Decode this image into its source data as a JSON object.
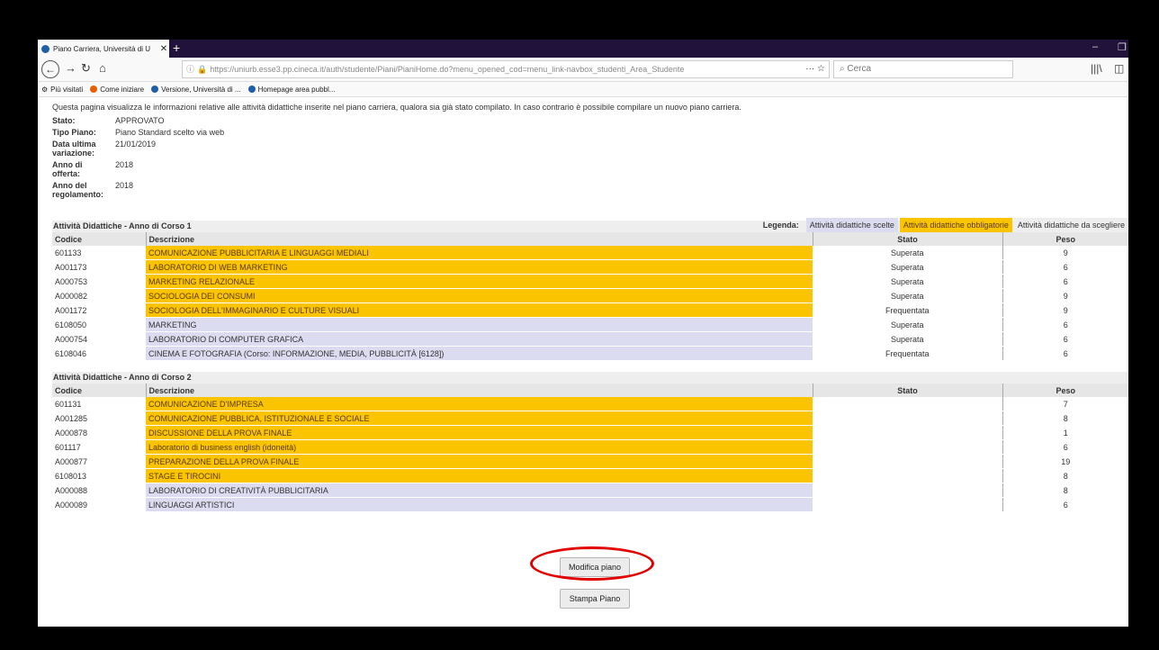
{
  "browser": {
    "tab_title": "Piano Carriera, Università di U",
    "tab_close": "✕",
    "url": "https://uniurb.esse3.pp.cineca.it/auth/studente/Piani/PianiHome.do?menu_opened_cod=menu_link-navbox_studenti_Area_Studente",
    "search_placeholder": "Cerca",
    "bookmarks": [
      "Più visitati",
      "Come iniziare",
      "Versione, Università di ...",
      "Homepage area pubbl..."
    ]
  },
  "intro": "Questa pagina visualizza le informazioni relative alle attività didattiche inserite nel piano carriera, qualora sia già stato compilato. In caso contrario è possibile compilare un nuovo piano carriera.",
  "info": {
    "stato_label": "Stato:",
    "stato": "APPROVATO",
    "tipo_label": "Tipo Piano:",
    "tipo": "Piano Standard scelto via web",
    "data_label": "Data ultima variazione:",
    "data": "21/01/2019",
    "anno_offerta_label": "Anno di offerta:",
    "anno_offerta": "2018",
    "anno_reg_label": "Anno del regolamento:",
    "anno_reg": "2018"
  },
  "legend": {
    "label": "Legenda:",
    "scelte": "Attività didattiche scelte",
    "obbligatorie": "Attività didattiche obbligatorie",
    "da_scegliere": "Attività didattiche da scegliere"
  },
  "columns": {
    "codice": "Codice",
    "descrizione": "Descrizione",
    "stato": "Stato",
    "peso": "Peso"
  },
  "colors": {
    "obbligatorie": "#fbc400",
    "scelte": "#dcdcf0"
  },
  "year1": {
    "title": "Attività Didattiche - Anno di Corso 1",
    "rows": [
      {
        "codice": "601133",
        "descrizione": "COMUNICAZIONE PUBBLICITARIA E LINGUAGGI MEDIALI",
        "stato": "Superata",
        "peso": "9",
        "tipo": "obbl"
      },
      {
        "codice": "A001173",
        "descrizione": "LABORATORIO DI WEB MARKETING",
        "stato": "Superata",
        "peso": "6",
        "tipo": "obbl"
      },
      {
        "codice": "A000753",
        "descrizione": "MARKETING RELAZIONALE",
        "stato": "Superata",
        "peso": "6",
        "tipo": "obbl"
      },
      {
        "codice": "A000082",
        "descrizione": "SOCIOLOGIA DEI CONSUMI",
        "stato": "Superata",
        "peso": "9",
        "tipo": "obbl"
      },
      {
        "codice": "A001172",
        "descrizione": "SOCIOLOGIA DELL'IMMAGINARIO E CULTURE VISUALI",
        "stato": "Frequentata",
        "peso": "9",
        "tipo": "obbl"
      },
      {
        "codice": "6108050",
        "descrizione": "MARKETING",
        "stato": "Superata",
        "peso": "6",
        "tipo": "scelte"
      },
      {
        "codice": "A000754",
        "descrizione": "LABORATORIO DI COMPUTER GRAFICA",
        "stato": "Superata",
        "peso": "6",
        "tipo": "scelte"
      },
      {
        "codice": "6108046",
        "descrizione": "CINEMA E FOTOGRAFIA (Corso: INFORMAZIONE, MEDIA, PUBBLICITÀ [6128])",
        "stato": "Frequentata",
        "peso": "6",
        "tipo": "scelte"
      }
    ]
  },
  "year2": {
    "title": "Attività Didattiche - Anno di Corso 2",
    "rows": [
      {
        "codice": "601131",
        "descrizione": "COMUNICAZIONE D'IMPRESA",
        "stato": "",
        "peso": "7",
        "tipo": "obbl"
      },
      {
        "codice": "A001285",
        "descrizione": "COMUNICAZIONE PUBBLICA, ISTITUZIONALE E SOCIALE",
        "stato": "",
        "peso": "8",
        "tipo": "obbl"
      },
      {
        "codice": "A000878",
        "descrizione": "DISCUSSIONE DELLA PROVA FINALE",
        "stato": "",
        "peso": "1",
        "tipo": "obbl"
      },
      {
        "codice": "601117",
        "descrizione": "Laboratorio di business english (idoneità)",
        "stato": "",
        "peso": "6",
        "tipo": "obbl"
      },
      {
        "codice": "A000877",
        "descrizione": "PREPARAZIONE DELLA PROVA FINALE",
        "stato": "",
        "peso": "19",
        "tipo": "obbl"
      },
      {
        "codice": "6108013",
        "descrizione": "STAGE E TIROCINI",
        "stato": "",
        "peso": "8",
        "tipo": "obbl"
      },
      {
        "codice": "A000088",
        "descrizione": "LABORATORIO DI CREATIVITÀ PUBBLICITARIA",
        "stato": "",
        "peso": "8",
        "tipo": "scelte"
      },
      {
        "codice": "A000089",
        "descrizione": "LINGUAGGI ARTISTICI",
        "stato": "",
        "peso": "6",
        "tipo": "scelte"
      }
    ]
  },
  "buttons": {
    "modifica": "Modifica piano",
    "stampa": "Stampa Piano"
  }
}
